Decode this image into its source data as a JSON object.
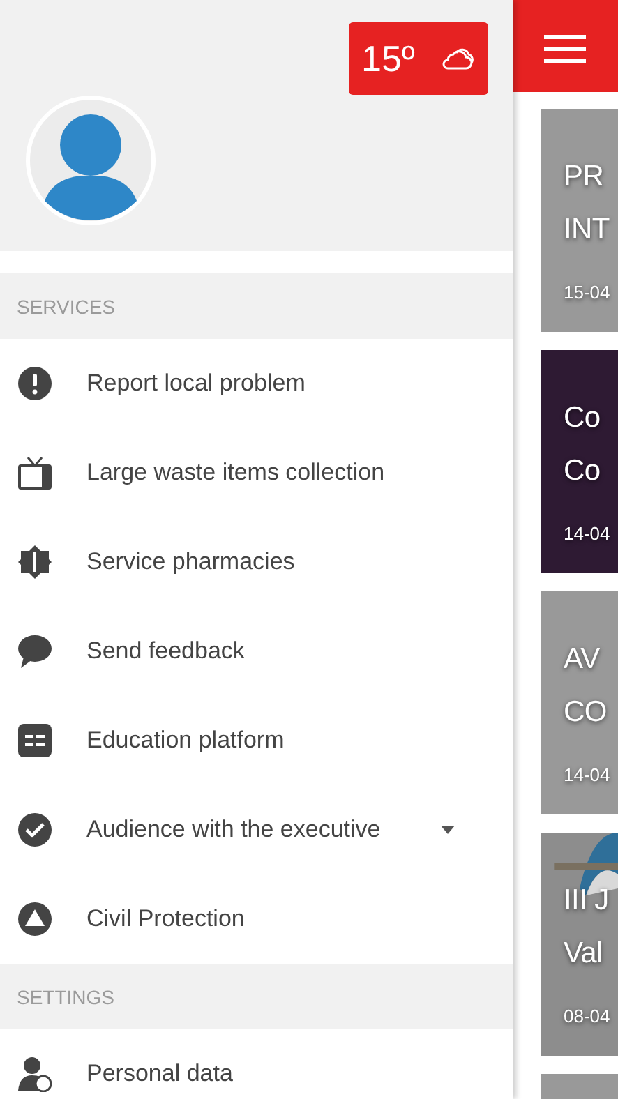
{
  "weather": {
    "temperature": "15º"
  },
  "sections": [
    {
      "title": "SERVICES",
      "items": [
        {
          "label": "Report local problem"
        },
        {
          "label": "Large waste items collection"
        },
        {
          "label": "Service pharmacies"
        },
        {
          "label": "Send feedback"
        },
        {
          "label": "Education platform"
        },
        {
          "label": "Audience with the executive",
          "expanded": false
        },
        {
          "label": "Civil Protection"
        }
      ]
    },
    {
      "title": "SETTINGS",
      "items": [
        {
          "label": "Personal data"
        }
      ]
    }
  ],
  "news": [
    {
      "kind": "plain",
      "title_lines": [
        "PR",
        "INT"
      ],
      "date": "15-04"
    },
    {
      "kind": "dark",
      "title_lines": [
        "Co",
        "Co"
      ],
      "date": "14-04"
    },
    {
      "kind": "plain",
      "title_lines": [
        "AV",
        "CO"
      ],
      "date": "14-04"
    },
    {
      "kind": "picture",
      "title_lines": [
        "III J",
        "Val"
      ],
      "date": "08-04"
    },
    {
      "kind": "plain"
    }
  ]
}
